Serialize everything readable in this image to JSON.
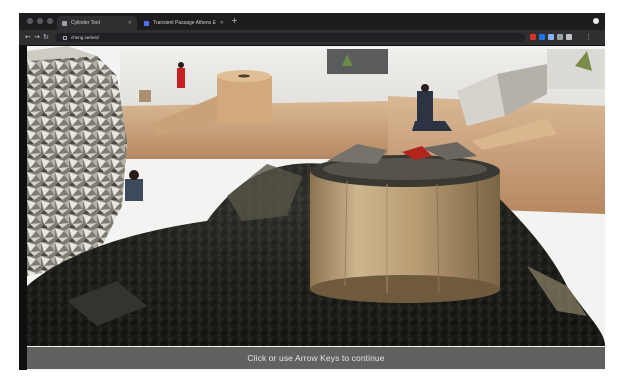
{
  "browser": {
    "tabs": [
      {
        "title": "Cylinder Tool",
        "active": true,
        "icon": "page-icon"
      },
      {
        "title": "Transient Passage Athens Eh…",
        "active": false,
        "icon": "site-icon"
      }
    ],
    "new_tab_label": "+",
    "url": "cheng.se/test/",
    "extension_colors": [
      "#d93025",
      "#1a73e8",
      "#8ab4f8",
      "#9aa0a6",
      "#bdc1c6"
    ]
  },
  "viewport": {
    "caption": "Click or use Arrow Keys to continue"
  },
  "colors": {
    "window_bg": "#0f0f10",
    "tabstrip_bg": "#1d1d1f",
    "toolbar_bg": "#2f2f32",
    "sand": "#c9a27a",
    "cardboard": "#b59a6e",
    "dark_mesh": "#1c1c1a"
  }
}
